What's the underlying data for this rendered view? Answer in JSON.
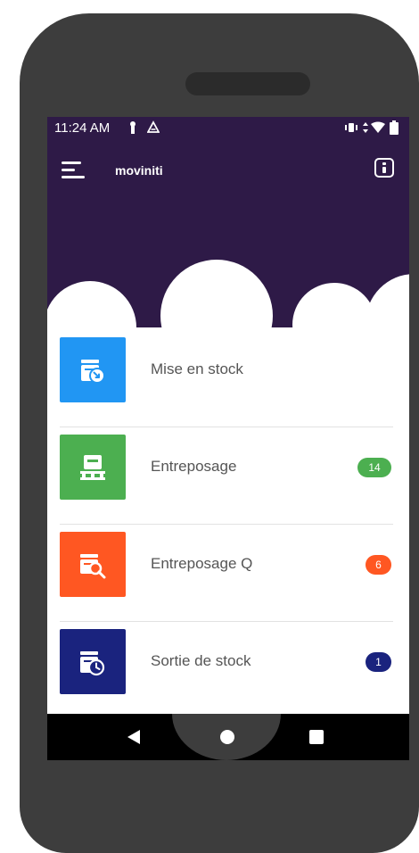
{
  "status_bar": {
    "time": "11:24 AM",
    "icons": [
      "notification-icon",
      "drive-icon",
      "vibrate-icon",
      "data-arrows-icon",
      "wifi-icon",
      "battery-icon"
    ]
  },
  "app_bar": {
    "title": "moviniti",
    "menu_icon": "menu-icon",
    "info_icon": "info-icon",
    "background_color": "#2e1a47"
  },
  "menu_items": [
    {
      "label": "Mise en stock",
      "icon": "stock-in-icon",
      "tile_color": "#2196f3",
      "badge": null
    },
    {
      "label": "Entreposage",
      "icon": "storage-pallet-icon",
      "tile_color": "#4caf50",
      "badge": "14",
      "badge_color": "#4caf50"
    },
    {
      "label": "Entreposage Q",
      "icon": "storage-search-icon",
      "tile_color": "#ff5722",
      "badge": "6",
      "badge_color": "#ff5722"
    },
    {
      "label": "Sortie de stock",
      "icon": "stock-out-clock-icon",
      "tile_color": "#1a237e",
      "badge": "1",
      "badge_color": "#1a237e"
    }
  ],
  "nav_bar": {
    "icons": [
      "back-icon",
      "home-icon",
      "recents-icon"
    ]
  }
}
